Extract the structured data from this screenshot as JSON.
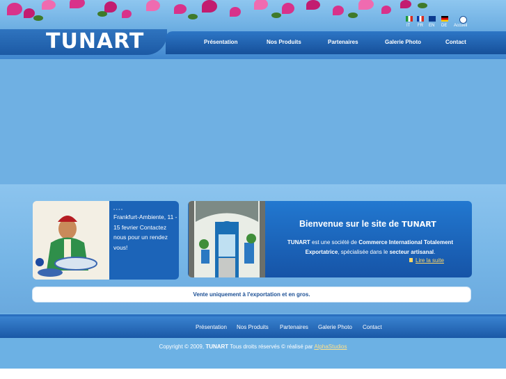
{
  "header": {
    "logo": "TUNART",
    "languages": [
      {
        "code": "IT"
      },
      {
        "code": "FR"
      },
      {
        "code": "EN"
      },
      {
        "code": "DE"
      }
    ],
    "home_label": "Accueil"
  },
  "nav": {
    "items": [
      "Présentation",
      "Nos Produits",
      "Partenaires",
      "Galerie Photo",
      "Contact"
    ]
  },
  "news": {
    "dash": "- - - -",
    "text": "Frankfurt-Ambiente, 11 - 15 fevrier Contactez nous pour un rendez vous!"
  },
  "welcome": {
    "title": "Bienvenue sur le site de",
    "brand": "TUNART",
    "body_brand": "TUNART",
    "body_1": " est une société de ",
    "body_bold_1": "Commerce International Totalement Exportatrice",
    "body_2": ", spécialisée dans le ",
    "body_bold_2": "secteur artisanal",
    "body_3": ".",
    "read_more": "Lire la suite"
  },
  "notice": "Vente uniquement à l'exportation et en gros.",
  "footer": {
    "nav": [
      "Présentation",
      "Nos Produits",
      "Partenaires",
      "Galerie Photo",
      "Contact"
    ],
    "copyright_prefix": "Copyright © 2009, ",
    "copyright_brand": "TUNART",
    "copyright_suffix": " Tous droits réservés ©  réalisé par ",
    "credit_link": "AlphaStudios"
  },
  "colors": {
    "nav_bg": "#1c5aa5",
    "card_bg": "#1c64b8",
    "link_accent": "#ffd766",
    "page_bg": "#6fb0e3"
  }
}
